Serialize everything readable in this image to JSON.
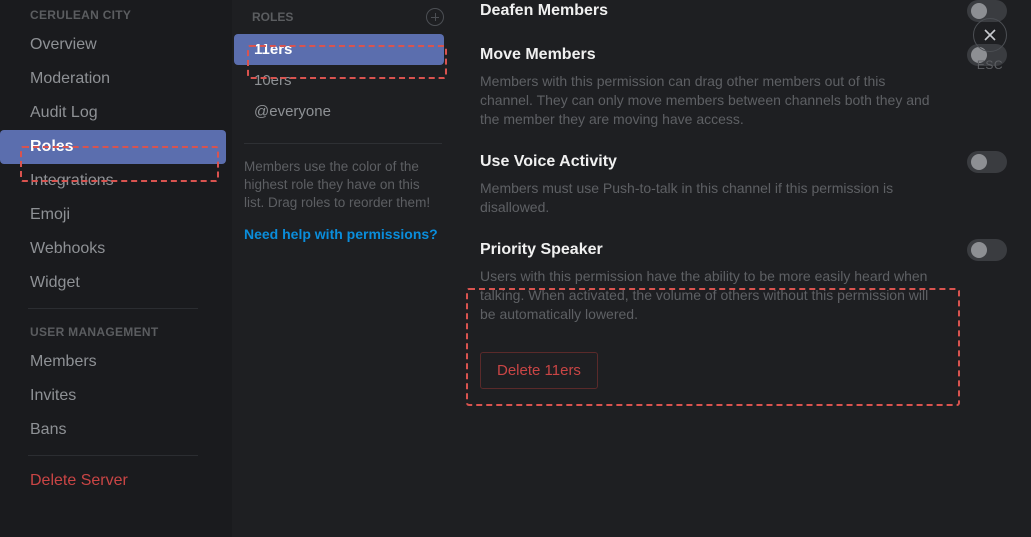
{
  "sidebar": {
    "server_heading": "CERULEAN CITY",
    "items": [
      "Overview",
      "Moderation",
      "Audit Log",
      "Roles",
      "Integrations",
      "Emoji",
      "Webhooks",
      "Widget"
    ],
    "user_heading": "USER MANAGEMENT",
    "user_items": [
      "Members",
      "Invites",
      "Bans"
    ],
    "delete_server": "Delete Server"
  },
  "roles": {
    "heading": "ROLES",
    "list": [
      "11ers",
      "10ers",
      "@everyone"
    ],
    "hint": "Members use the color of the highest role they have on this list. Drag roles to reorder them!",
    "help": "Need help with permissions?"
  },
  "perms": {
    "deafen": {
      "title": "Deafen Members",
      "desc": ""
    },
    "move": {
      "title": "Move Members",
      "desc": "Members with this permission can drag other members out of this channel. They can only move members between channels both they and the member they are moving have access."
    },
    "voice": {
      "title": "Use Voice Activity",
      "desc": "Members must use Push-to-talk in this channel if this permission is disallowed."
    },
    "priority": {
      "title": "Priority Speaker",
      "desc": "Users with this permission have the ability to be more easily heard when talking. When activated, the volume of others without this permission will be automatically lowered."
    },
    "delete_role": "Delete 11ers"
  },
  "close": {
    "label": "ESC"
  }
}
